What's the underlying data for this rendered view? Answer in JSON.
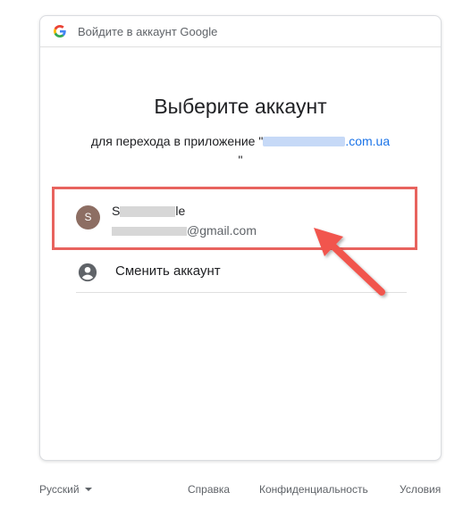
{
  "header": {
    "text": "Войдите в аккаунт Google",
    "logo_icon": "google-g-logo"
  },
  "title": "Выберите аккаунт",
  "subtitle": {
    "prefix": "для перехода в приложение \"",
    "domain_suffix": ".com.ua",
    "closing_quote": "\""
  },
  "account": {
    "initial": "S",
    "name_start": "S",
    "name_end": "le",
    "email_domain": "@gmail.com",
    "avatar_color": "#8d6e63"
  },
  "switch_account": {
    "label": "Сменить аккаунт",
    "icon": "account-circle-icon"
  },
  "annotation": {
    "highlight_color": "#e8635e"
  },
  "footer": {
    "language": "Русский",
    "help": "Справка",
    "privacy": "Конфиденциальность",
    "terms": "Условия"
  }
}
